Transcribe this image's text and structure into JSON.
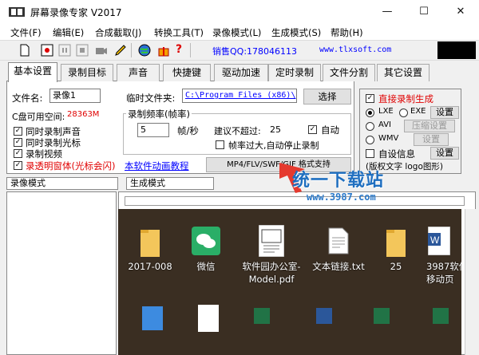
{
  "window": {
    "title": "屏幕录像专家 V2017",
    "min": "—",
    "max": "☐",
    "close": "✕"
  },
  "menu": [
    "文件(F)",
    "编辑(E)",
    "合成截取(J)",
    "转换工具(T)",
    "录像模式(L)",
    "生成模式(S)",
    "帮助(H)"
  ],
  "toolbar": {
    "sales_qq": "销售QQ:178046113",
    "website": "www.tlxsoft.com"
  },
  "tabs": [
    "基本设置",
    "录制目标",
    "声音",
    "快捷键",
    "驱动加速",
    "定时录制",
    "文件分割",
    "其它设置"
  ],
  "basic": {
    "filename_label": "文件名:",
    "filename_value": "录像1",
    "temp_folder_label": "临时文件夹:",
    "temp_folder_value": "C:\\Program Files (x86)\\",
    "choose_btn": "选择",
    "disk_label": "C盘可用空间:",
    "disk_value": "28363M",
    "checks": [
      "同时录制声音",
      "同时录制光标",
      "录制视频",
      "录透明窗体(光标会闪)"
    ],
    "animation_link": "本软件动画教程",
    "rate_group": "录制频率(帧率)",
    "rate_value": "5",
    "rate_unit": "帧/秒",
    "suggest_label": "建议不超过:",
    "suggest_value": "25",
    "auto_label": "自动",
    "stop_label": "帧率过大,自动停止录制",
    "formats_btn": "MP4/FLV/SWF/GIF 格式支持"
  },
  "right": {
    "direct_label": "直接录制生成",
    "lxe": "LXE",
    "exe": "EXE",
    "settings": "设置",
    "avi": "AVI",
    "compress": "压缩设置",
    "wmv": "WMV",
    "wmv_settings": "设置",
    "custom_info": "自设信息",
    "info_settings": "设置",
    "copyright": "(版权文字 logo图形)"
  },
  "bottom": {
    "rec_mode": "录像模式",
    "gen_mode": "生成模式"
  },
  "watermark": {
    "brand": "统一下载站",
    "url": "www.3987.com"
  },
  "desktop": [
    "2017-008",
    "微信",
    "软件园办公室-Model.pdf",
    "文本链接.txt",
    "25",
    "3987软件截移动页"
  ],
  "colors": {
    "accent": "#0000ff",
    "red": "#e00000"
  }
}
